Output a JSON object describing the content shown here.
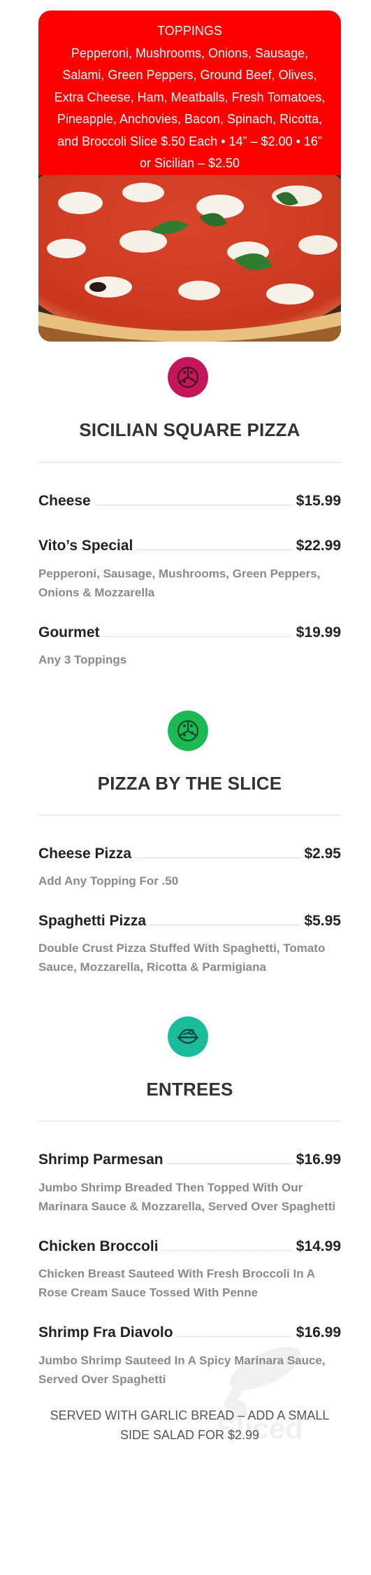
{
  "toppings": {
    "title": "TOPPINGS",
    "lines": [
      "Pepperoni, Mushrooms, Onions, Sausage,",
      "Salami, Green Peppers, Ground Beef, Olives,",
      "Extra Cheese, Ham, Meatballs, Fresh Tomatoes,",
      "Pineapple, Anchovies, Bacon, Spinach, Ricotta,",
      "and Broccoli Slice $.50 Each • 14” – $2.00 • 16”",
      "or Sicilian – $2.50"
    ],
    "bg_color": "#ff0000"
  },
  "sections": {
    "sicilian": {
      "title": "SICILIAN SQUARE PIZZA",
      "icon": "pizza-icon",
      "icon_color": "#c2185b",
      "items": [
        {
          "name": "Cheese",
          "price": "$15.99",
          "desc": ""
        },
        {
          "name": "Vito’s Special",
          "price": "$22.99",
          "desc": "Pepperoni, Sausage, Mushrooms, Green Peppers, Onions & Mozzarella"
        },
        {
          "name": "Gourmet",
          "price": "$19.99",
          "desc": "Any 3 Toppings"
        }
      ]
    },
    "slice": {
      "title": "PIZZA BY THE SLICE",
      "icon": "pizza-icon",
      "icon_color": "#1db954",
      "items": [
        {
          "name": "Cheese Pizza",
          "price": "$2.95",
          "desc": "Add Any Topping For .50"
        },
        {
          "name": "Spaghetti Pizza",
          "price": "$5.95",
          "desc": "Double Crust Pizza Stuffed With Spaghetti, Tomato Sauce, Mozzarella, Ricotta & Parmigiana"
        }
      ]
    },
    "entrees": {
      "title": "ENTREES",
      "icon": "pasta-bowl-icon",
      "icon_color": "#1abc9c",
      "items": [
        {
          "name": "Shrimp Parmesan",
          "price": "$16.99",
          "desc": "Jumbo Shrimp Breaded Then Topped With Our Marinara Sauce & Mozzarella, Served Over Spaghetti"
        },
        {
          "name": "Chicken Broccoli",
          "price": "$14.99",
          "desc": "Chicken Breast Sauteed With Fresh Broccoli In A Rose Cream Sauce Tossed With Penne"
        },
        {
          "name": "Shrimp Fra Diavolo",
          "price": "$16.99",
          "desc": "Jumbo Shrimp Sauteed In A Spicy Marinara Sauce, Served Over Spaghetti"
        }
      ]
    }
  },
  "footnote": {
    "line1": "SERVED WITH GARLIC BREAD – ADD A SMALL",
    "line2": "SIDE SALAD FOR $2.99"
  },
  "watermark": {
    "text": "Sliced"
  }
}
